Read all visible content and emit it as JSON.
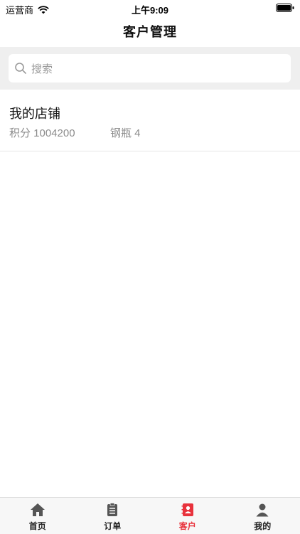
{
  "status_bar": {
    "carrier": "运营商",
    "time": "上午9:09"
  },
  "nav": {
    "title": "客户管理"
  },
  "search": {
    "placeholder": "搜索"
  },
  "customers": [
    {
      "name": "我的店铺",
      "points_text": "积分 1004200",
      "cylinders_text": "钢瓶 4"
    }
  ],
  "tabbar": {
    "items": [
      {
        "label": "首页",
        "icon": "home-icon",
        "active": false
      },
      {
        "label": "订单",
        "icon": "clipboard-icon",
        "active": false
      },
      {
        "label": "客户",
        "icon": "contacts-book-icon",
        "active": true
      },
      {
        "label": "我的",
        "icon": "person-icon",
        "active": false
      }
    ],
    "active_color": "#e8323c",
    "inactive_color": "#555555"
  }
}
